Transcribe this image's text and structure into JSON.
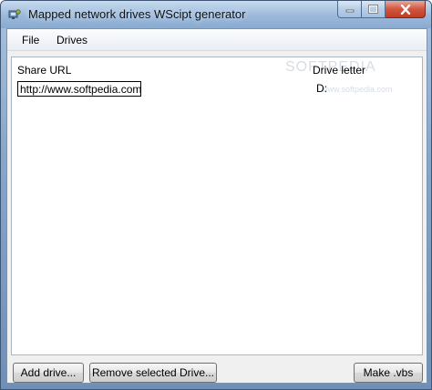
{
  "window": {
    "title": "Mapped network drives WScipt generator",
    "icon": "app-icon"
  },
  "menu": {
    "file": "File",
    "drives": "Drives"
  },
  "grid": {
    "columns": [
      "Share URL",
      "Drive letter"
    ],
    "rows": [
      {
        "url": "http://www.softpedia.com",
        "letter": "D:"
      }
    ]
  },
  "watermark": {
    "logo": "SOFTPEDIA",
    "url": "www.softpedia.com"
  },
  "buttons": {
    "add": "Add drive...",
    "remove": "Remove selected Drive...",
    "make": "Make .vbs"
  },
  "colors": {
    "titlebar": "#9ab8da",
    "close_button": "#c23b22",
    "client_background": "#f0f0f0"
  }
}
